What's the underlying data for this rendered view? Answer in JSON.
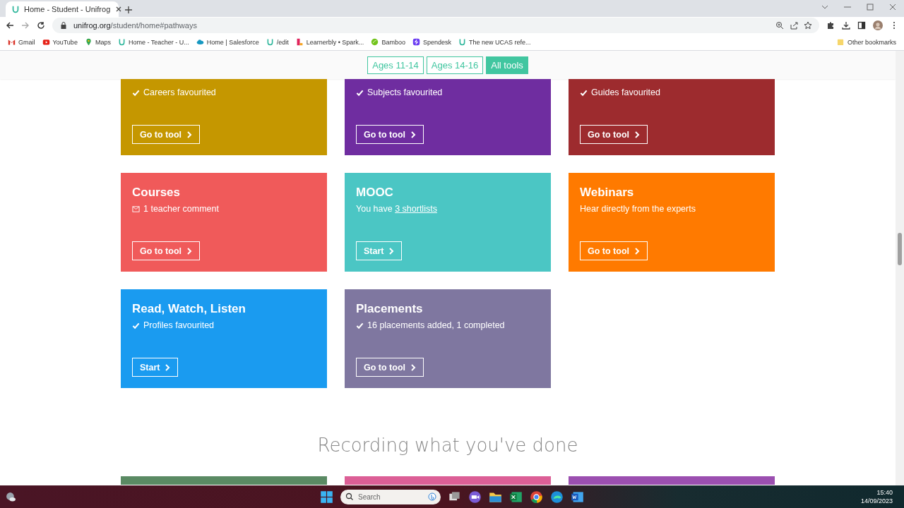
{
  "browser": {
    "tab": {
      "title": "Home - Student - Unifrog"
    },
    "url": {
      "domain": "unifrog.org",
      "path": "/student/home#pathways"
    },
    "bookmarks": [
      {
        "label": "Gmail",
        "kind": "mail",
        "color": "#d93025"
      },
      {
        "label": "YouTube",
        "kind": "play",
        "color": "#e62117"
      },
      {
        "label": "Maps",
        "kind": "pin",
        "color": "#34a853"
      },
      {
        "label": "Home - Teacher - U...",
        "kind": "logo",
        "color": "#2bb59a"
      },
      {
        "label": "Home | Salesforce",
        "kind": "cloud",
        "color": "#1798c1"
      },
      {
        "label": "/edit",
        "kind": "logo",
        "color": "#2bb59a"
      },
      {
        "label": "Learnerbly • Spark...",
        "kind": "bars",
        "color": "#e0245e"
      },
      {
        "label": "Bamboo",
        "kind": "leaf",
        "color": "#73c41d"
      },
      {
        "label": "Spendesk",
        "kind": "square",
        "color": "#6b3df2"
      },
      {
        "label": "The new UCAS refe...",
        "kind": "logo",
        "color": "#2bb59a"
      }
    ],
    "other_bookmarks": "Other bookmarks"
  },
  "filters": [
    {
      "label": "Ages 11-14",
      "selected": false
    },
    {
      "label": "Ages 14-16",
      "selected": false
    },
    {
      "label": "All tools",
      "selected": true
    }
  ],
  "cards": [
    {
      "color": "#c59700",
      "status": {
        "kind": "check",
        "text": "Careers favourited"
      },
      "button": "Go to tool"
    },
    {
      "color": "#6f2da0",
      "status": {
        "kind": "check",
        "text": "Subjects favourited"
      },
      "button": "Go to tool"
    },
    {
      "color": "#9d2b2e",
      "status": {
        "kind": "check",
        "text": "Guides favourited"
      },
      "button": "Go to tool"
    },
    {
      "color": "#f05a5a",
      "title": "Courses",
      "status": {
        "kind": "mail",
        "text": "1 teacher comment"
      },
      "button": "Go to tool"
    },
    {
      "color": "#4bc6c4",
      "title": "MOOC",
      "status": {
        "text": "You have ",
        "link": "3 shortlists"
      },
      "button": "Start"
    },
    {
      "color": "#ff7a00",
      "title": "Webinars",
      "status": {
        "text": "Hear directly from the experts"
      },
      "button": "Go to tool"
    },
    {
      "color": "#1a9bf0",
      "title": "Read, Watch, Listen",
      "status": {
        "kind": "check",
        "text": "Profiles favourited"
      },
      "button": "Start"
    },
    {
      "color": "#7f77a0",
      "title": "Placements",
      "status": {
        "kind": "check",
        "text": "16 placements added, 1 completed"
      },
      "button": "Go to tool"
    }
  ],
  "section_heading": "Recording what you've done",
  "recording_cards": [
    {
      "color": "#5a8a63"
    },
    {
      "color": "#dc5f96"
    },
    {
      "color": "#9b4fb0"
    }
  ],
  "taskbar": {
    "search": {
      "placeholder": "Search"
    },
    "time": "15:40",
    "date": "14/09/2023"
  }
}
